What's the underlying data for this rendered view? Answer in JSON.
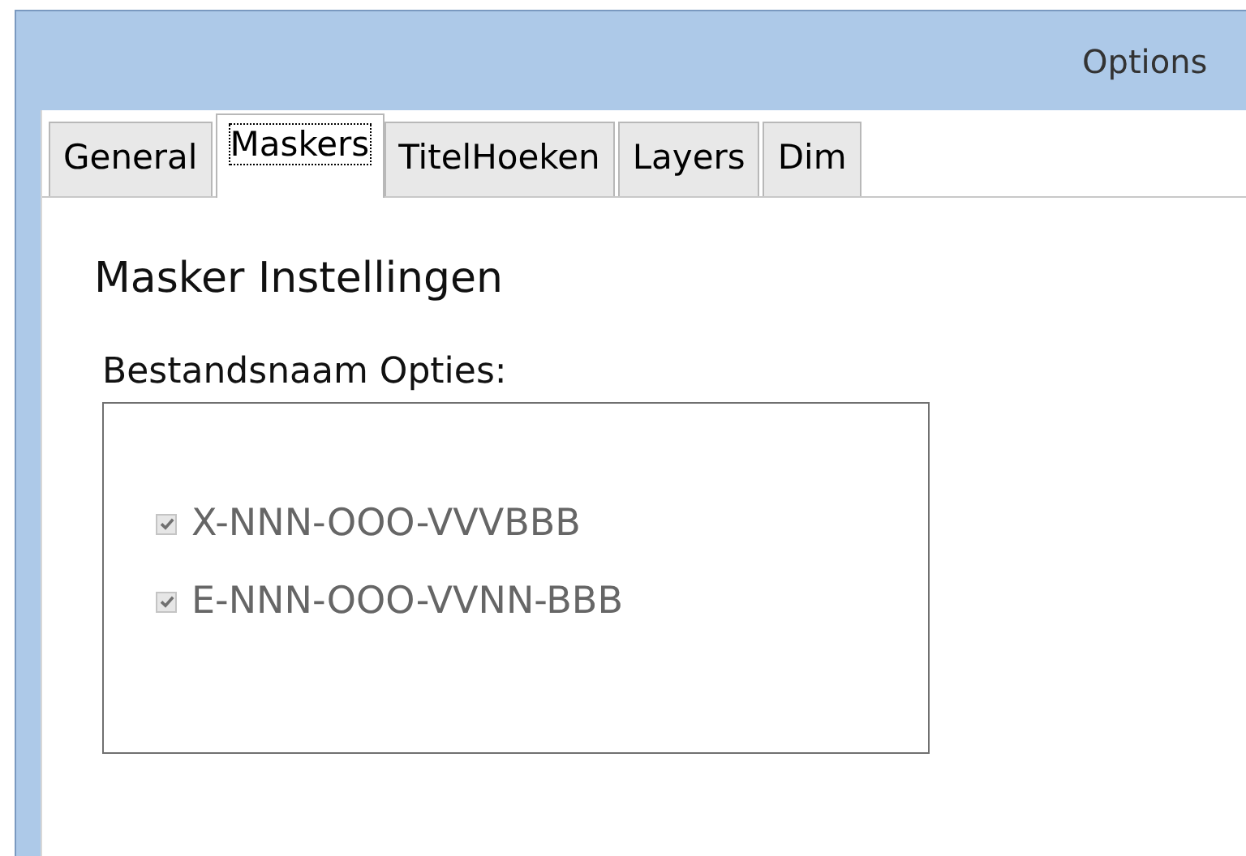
{
  "window": {
    "title": "Options"
  },
  "tabs": [
    {
      "label": "General",
      "selected": false
    },
    {
      "label": "Maskers",
      "selected": true
    },
    {
      "label": "TitelHoeken",
      "selected": false
    },
    {
      "label": "Layers",
      "selected": false
    },
    {
      "label": "Dim",
      "selected": false
    }
  ],
  "heading": "Masker Instellingen",
  "group": {
    "label": "Bestandsnaam Opties:",
    "options": [
      {
        "label": "X-NNN-OOO-VVVBBB",
        "checked": true,
        "disabled": true
      },
      {
        "label": "E-NNN-OOO-VVNN-BBB",
        "checked": true,
        "disabled": true
      }
    ]
  }
}
